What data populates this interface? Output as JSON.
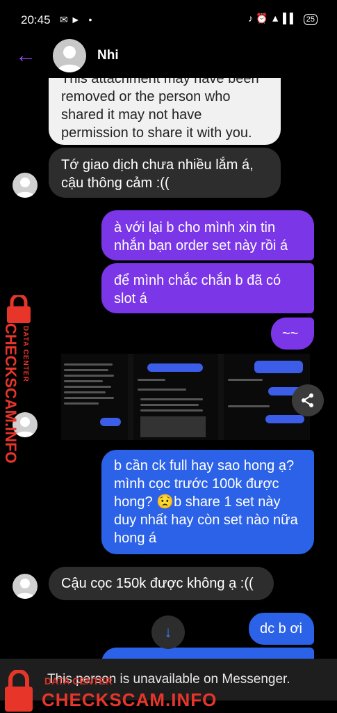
{
  "status": {
    "time": "20:45",
    "battery": "25"
  },
  "header": {
    "contact_name": "Nhi"
  },
  "messages": {
    "attachment_notice": "This attachment may have been removed or the person who shared it may not have permission to share it with you.",
    "in_1": "Tớ giao dịch chưa nhiều lắm á, cậu thông cảm :((",
    "out_1": "à với lại b cho mình xin tin nhắn bạn order set này rồi á",
    "out_2": "để mình chắc chắn b đã có slot á",
    "out_3": "~~",
    "out_4": "b cần ck full hay sao hong ạ? mình cọc trước 100k được hong? 😟b share 1 set này duy nhất hay còn set nào nữa hong á",
    "in_2": "Cậu cọc 150k được không ạ :((",
    "out_5": "dc b ơi"
  },
  "banner": {
    "unavailable": "This person is unavailable on Messenger."
  },
  "watermark": {
    "side_big": "CHECKSCAM.INFO",
    "side_small": "DATA CENTER",
    "bottom_big": "CHECKSCAM.INFO",
    "bottom_small": "DATA CENTER"
  },
  "colors": {
    "accent": "#7b36e8",
    "blue": "#2b62e8",
    "watermark": "#e8352a"
  },
  "icons": {
    "back": "back-arrow-icon",
    "share": "share-icon",
    "scroll_down": "arrow-down-icon",
    "lock": "lock-icon"
  }
}
